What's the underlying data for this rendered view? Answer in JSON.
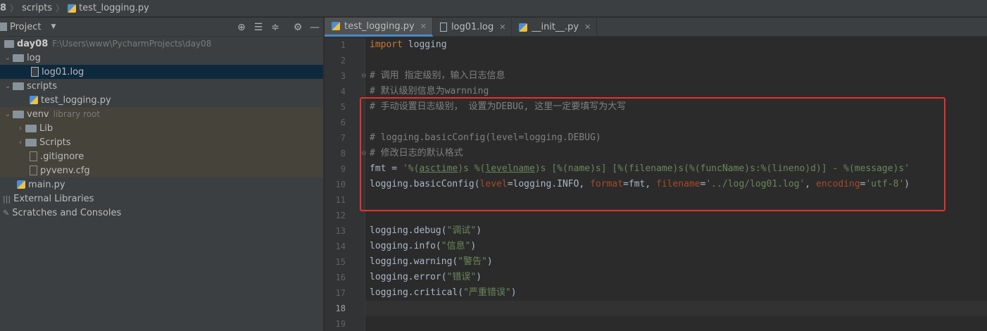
{
  "breadcrumb": {
    "project": "8",
    "folder": "scripts",
    "file": "test_logging.py"
  },
  "project_panel": {
    "title": "Project",
    "tree": [
      {
        "label": "day08",
        "path": "F:\\Users\\www\\PycharmProjects\\day08"
      },
      {
        "label": "log"
      },
      {
        "label": "log01.log"
      },
      {
        "label": "scripts"
      },
      {
        "label": "test_logging.py"
      },
      {
        "label": "venv",
        "note": "library root"
      },
      {
        "label": "Lib"
      },
      {
        "label": "Scripts"
      },
      {
        "label": ".gitignore"
      },
      {
        "label": "pyvenv.cfg"
      },
      {
        "label": "main.py"
      },
      {
        "label": "External Libraries"
      },
      {
        "label": "Scratches and Consoles"
      }
    ]
  },
  "tabs": [
    {
      "label": "test_logging.py"
    },
    {
      "label": "log01.log"
    },
    {
      "label": "__init__.py"
    }
  ],
  "editor": {
    "line_numbers": [
      "1",
      "2",
      "3",
      "4",
      "5",
      "6",
      "7",
      "8",
      "9",
      "10",
      "11",
      "12",
      "13",
      "14",
      "15",
      "16",
      "17",
      "18",
      "19"
    ],
    "lines": {
      "l1_kw": "import",
      "l1_rest": " logging",
      "l3": "# 调用 指定级别，输入日志信息",
      "l4": "# 默认级别信息为warnning",
      "l5": "# 手动设置日志级别， 设置为DEBUG, 这里一定要填写为大写",
      "l7": "# logging.basicConfig(level=logging.DEBUG)",
      "l8": "# 修改日志的默认格式",
      "l9_a": "fmt = ",
      "l9_b": "'%(",
      "l9_c": "asctime",
      "l9_d": ")s %(",
      "l9_e": "levelname",
      "l9_f": ")s [%(name)s] [%(filename)s(%(funcName)s:%(lineno)d)] - %(message)s'",
      "l10_a": "logging.basicConfig(",
      "l10_b": "level",
      "l10_c": "=logging.INFO, ",
      "l10_d": "format",
      "l10_e": "=fmt, ",
      "l10_f": "filename",
      "l10_g": "=",
      "l10_h": "'../log/log01.log'",
      "l10_i": ", ",
      "l10_j": "encoding",
      "l10_k": "=",
      "l10_l": "'utf-8'",
      "l10_m": ")",
      "l13_a": "logging.debug(",
      "l13_b": "\"调试\"",
      "l13_c": ")",
      "l14_a": "logging.info(",
      "l14_b": "\"信息\"",
      "l14_c": ")",
      "l15_a": "logging.warning(",
      "l15_b": "\"警告\"",
      "l15_c": ")",
      "l16_a": "logging.error(",
      "l16_b": "\"错误\"",
      "l16_c": ")",
      "l17_a": "logging.critical(",
      "l17_b": "\"严重错误\"",
      "l17_c": ")"
    }
  },
  "colors": {
    "highlight_box": "#e5322d",
    "keyword": "#cc7832",
    "comment": "#808080",
    "string": "#6a8759"
  }
}
